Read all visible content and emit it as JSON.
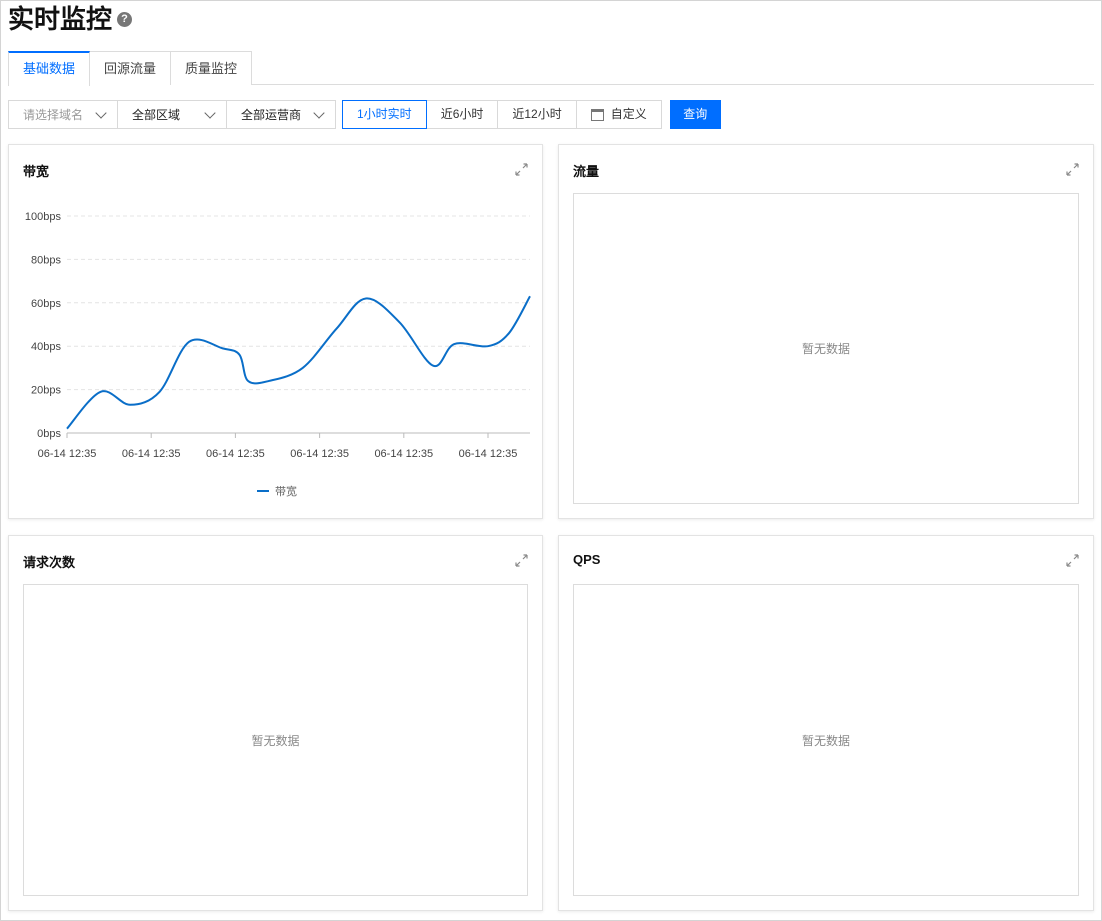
{
  "page": {
    "title": "实时监控",
    "help_icon": "?"
  },
  "tabs": [
    {
      "label": "基础数据",
      "active": true
    },
    {
      "label": "回源流量",
      "active": false
    },
    {
      "label": "质量监控",
      "active": false
    }
  ],
  "filters": {
    "domain_placeholder": "请选择域名",
    "region": "全部区域",
    "isp": "全部运营商"
  },
  "time_ranges": [
    {
      "label": "1小时实时",
      "active": true
    },
    {
      "label": "近6小时",
      "active": false
    },
    {
      "label": "近12小时",
      "active": false
    },
    {
      "label": "自定义",
      "active": false,
      "icon": "calendar-icon"
    }
  ],
  "query_label": "查询",
  "colors": {
    "accent": "#006eff",
    "series": "#0a6ec8"
  },
  "cards": {
    "bandwidth": {
      "title": "带宽"
    },
    "traffic": {
      "title": "流量",
      "empty": "暂无数据"
    },
    "requests": {
      "title": "请求次数",
      "empty": "暂无数据"
    },
    "qps": {
      "title": "QPS",
      "empty": "暂无数据"
    }
  },
  "chart_data": {
    "type": "line",
    "title": "带宽",
    "x_ticks": [
      "06-14 12:35",
      "06-14 12:35",
      "06-14 12:35",
      "06-14 12:35",
      "06-14 12:35",
      "06-14 12:35"
    ],
    "y_ticks": [
      "0bps",
      "20bps",
      "40bps",
      "60bps",
      "80bps",
      "100bps"
    ],
    "ylim": [
      0,
      100
    ],
    "xlim": [
      0,
      5.5
    ],
    "grid": true,
    "legend_position": "bottom",
    "series": [
      {
        "name": "带宽",
        "color": "#0a6ec8",
        "x": [
          0,
          0.4,
          0.75,
          1.1,
          1.45,
          1.85,
          2.05,
          2.15,
          2.4,
          2.8,
          3.2,
          3.55,
          3.95,
          4.35,
          4.6,
          5.0,
          5.25,
          5.5
        ],
        "y": [
          2,
          19,
          13,
          19,
          42,
          39,
          36,
          24,
          24,
          30,
          48,
          62,
          51,
          31,
          41,
          40,
          46,
          63
        ]
      }
    ]
  }
}
